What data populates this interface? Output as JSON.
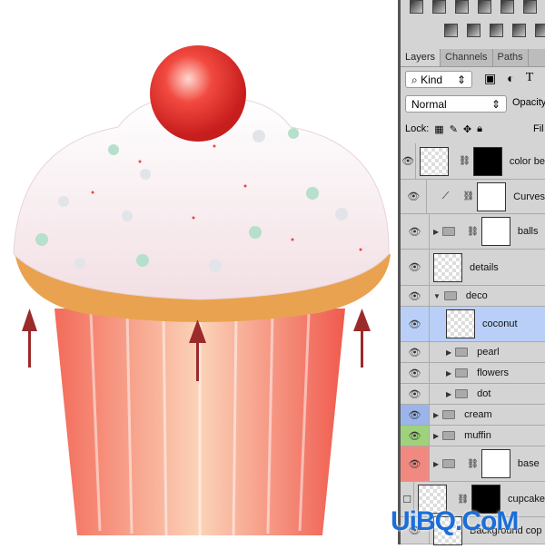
{
  "panel": {
    "tabs": [
      "Layers",
      "Channels",
      "Paths"
    ],
    "filter": "Kind",
    "blend_mode": "Normal",
    "opacity_label": "Opacity",
    "lock_label": "Lock:",
    "fill_label": "Fil",
    "layers": [
      {
        "name": "color be",
        "type": "layer-mask"
      },
      {
        "name": "Curves",
        "type": "adjustment"
      },
      {
        "name": "balls",
        "type": "group-mask"
      },
      {
        "name": "details",
        "type": "layer"
      },
      {
        "name": "deco",
        "type": "group-open"
      },
      {
        "name": "coconut",
        "type": "layer",
        "selected": true
      },
      {
        "name": "pearl",
        "type": "group"
      },
      {
        "name": "flowers",
        "type": "group"
      },
      {
        "name": "dot",
        "type": "group"
      },
      {
        "name": "cream",
        "type": "group",
        "color": "#9bb5ea"
      },
      {
        "name": "muffin",
        "type": "group",
        "color": "#9fd27c"
      },
      {
        "name": "base",
        "type": "group-mask",
        "color": "#f08a80"
      },
      {
        "name": "cupcake",
        "type": "smart-mask",
        "hidden": true
      },
      {
        "name": "Background cop",
        "type": "layer"
      }
    ]
  },
  "watermark": "UiBQ.CoM",
  "colors": {
    "selected": "#b9cff7",
    "arrow": "#9b2a2a"
  }
}
